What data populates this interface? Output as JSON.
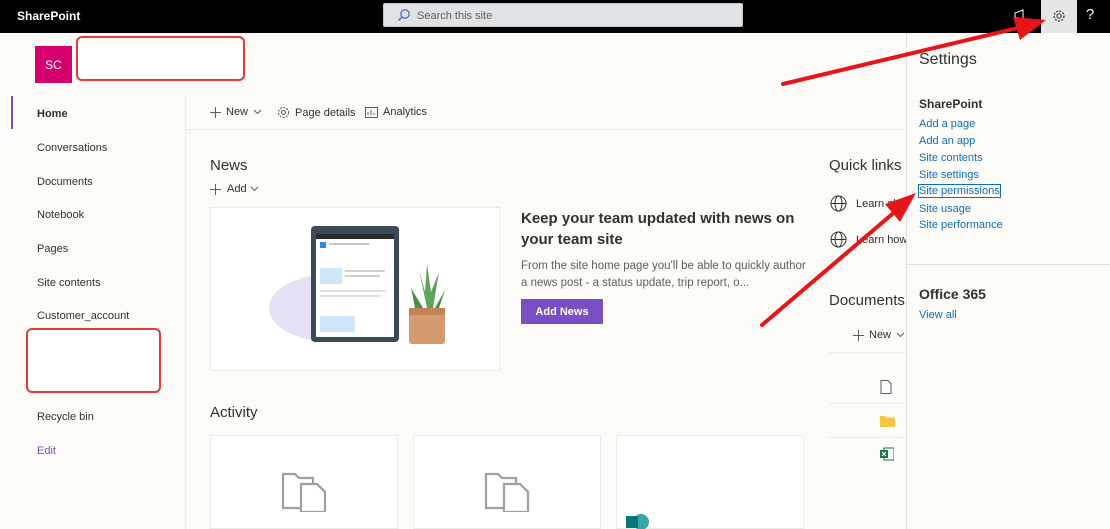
{
  "app": {
    "brand": "SharePoint",
    "accent": "#7a4fc4",
    "logo_color": "#d5006d"
  },
  "search": {
    "placeholder": "Search this site"
  },
  "topbar": {
    "help_label": "?"
  },
  "site": {
    "logo_initials": "SC"
  },
  "nav": {
    "items": [
      {
        "label": "Home"
      },
      {
        "label": "Conversations"
      },
      {
        "label": "Documents"
      },
      {
        "label": "Notebook"
      },
      {
        "label": "Pages"
      },
      {
        "label": "Site contents"
      },
      {
        "label": "Customer_account"
      },
      {
        "label": "Recycle bin"
      }
    ],
    "edit_label": "Edit"
  },
  "commandbar": {
    "new_label": "New",
    "page_details_label": "Page details",
    "analytics_label": "Analytics"
  },
  "news": {
    "heading": "News",
    "add_label": "Add",
    "title": "Keep your team updated with news on your team site",
    "description": "From the site home page you'll be able to quickly author a news post - a status update, trip report, o...",
    "button_label": "Add News"
  },
  "quick_links": {
    "heading": "Quick links",
    "items": [
      {
        "label": "Learn ab"
      },
      {
        "label": "Learn how"
      }
    ]
  },
  "documents": {
    "heading": "Documents",
    "new_label": "New"
  },
  "activity": {
    "heading": "Activity"
  },
  "settings": {
    "title": "Settings",
    "sharepoint_heading": "SharePoint",
    "links": [
      {
        "label": "Add a page"
      },
      {
        "label": "Add an app"
      },
      {
        "label": "Site contents"
      },
      {
        "label": "Site settings"
      },
      {
        "label": "Site permissions"
      },
      {
        "label": "Site usage"
      },
      {
        "label": "Site performance"
      }
    ],
    "office_heading": "Office 365",
    "view_all_label": "View all"
  }
}
